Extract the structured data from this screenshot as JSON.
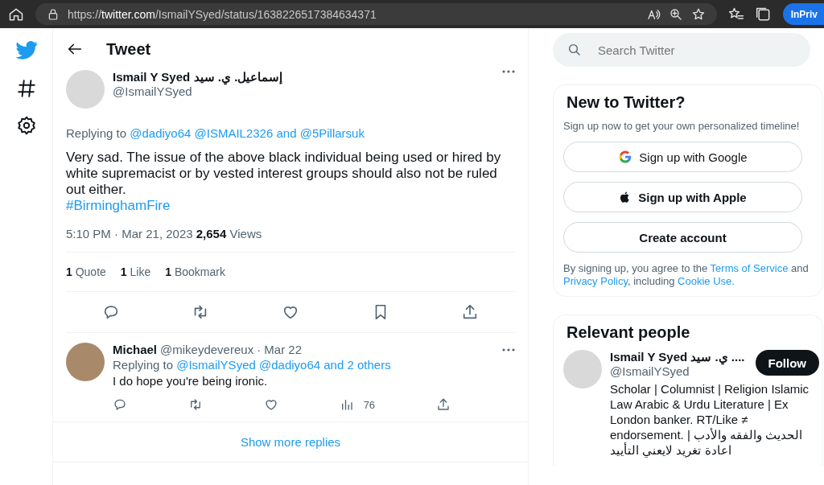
{
  "browser": {
    "url_parts": [
      {
        "kind": "scheme",
        "text": "https://"
      },
      {
        "kind": "host",
        "text": "twitter.com"
      },
      {
        "kind": "path",
        "text": "/IsmailYSyed/status/1638226517384634371"
      }
    ],
    "profile_button": "InPriv"
  },
  "header": {
    "title": "Tweet"
  },
  "tweet": {
    "name": "Ismail Y Syed",
    "name_native": "إسماعيل. ي. سيد",
    "handle": "@IsmailYSyed",
    "replying": [
      {
        "kind": "text",
        "text": "Replying to"
      },
      {
        "kind": "link",
        "text": "@dadiyo64"
      },
      {
        "kind": "link",
        "text": "@ISMAIL2326"
      },
      {
        "kind": "link",
        "text": "and"
      },
      {
        "kind": "link",
        "text": "@5Pillarsuk"
      }
    ],
    "text": "Very sad. The issue of the above black individual being used or hired by white supremacist or by vested interest groups should also not be ruled out either.",
    "hashtag": "#BirminghamFire",
    "time": "5:10 PM · Mar 21, 2023",
    "views_count": "2,654",
    "views_label": "Views",
    "stats": [
      {
        "count": "1",
        "label": "Quote"
      },
      {
        "count": "1",
        "label": "Like"
      },
      {
        "count": "1",
        "label": "Bookmark"
      }
    ]
  },
  "reply": {
    "name": "Michael",
    "handle": "@mikeydevereux",
    "date": "· Mar 22",
    "replying": [
      {
        "kind": "text",
        "text": "Replying to"
      },
      {
        "kind": "link",
        "text": "@IsmailYSyed"
      },
      {
        "kind": "link",
        "text": "@dadiyo64"
      },
      {
        "kind": "link",
        "text": "and 2 others"
      }
    ],
    "text": "I do hope you're being ironic.",
    "views": "76"
  },
  "show_more": "Show more replies",
  "search": {
    "placeholder": "Search Twitter"
  },
  "signup": {
    "title": "New to Twitter?",
    "subtitle": "Sign up now to get your own personalized timeline!",
    "buttons": [
      {
        "kind": "google",
        "label": "Sign up with Google"
      },
      {
        "kind": "apple",
        "label": "Sign up with Apple"
      },
      {
        "kind": "plain",
        "label": "Create account"
      }
    ],
    "legal": [
      {
        "kind": "text",
        "text": "By signing up, you agree to the "
      },
      {
        "kind": "link",
        "text": "Terms of Service"
      },
      {
        "kind": "text",
        "text": " and "
      },
      {
        "kind": "link",
        "text": "Privacy Policy"
      },
      {
        "kind": "text",
        "text": ", including "
      },
      {
        "kind": "link",
        "text": "Cookie Use."
      }
    ]
  },
  "relevant": {
    "title": "Relevant people",
    "person": {
      "name": "Ismail Y Syed ي. سيد ....",
      "handle": "@IsmailYSyed",
      "follow": "Follow",
      "bio": "Scholar | Columnist | Religion Islamic Law Arabic & Urdu Literature | Ex London banker. RT/Like ≠ endorsement. | الحديث والفقه والأدب اعادة تغريد لايعني التأييد"
    }
  }
}
